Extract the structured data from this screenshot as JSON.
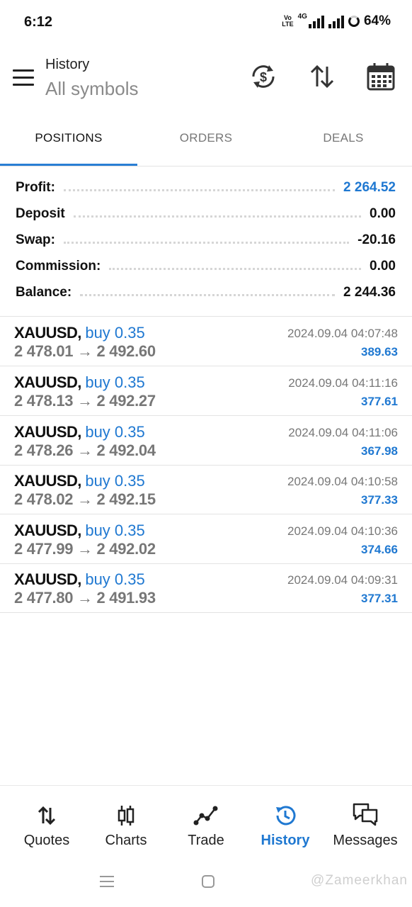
{
  "status_bar": {
    "time": "6:12",
    "volte": "Vo\nLTE",
    "network": "4G",
    "battery": "64%"
  },
  "app_bar": {
    "title": "History",
    "subtitle": "All symbols",
    "icons": [
      "currency-sync-icon",
      "sort-icon",
      "calendar-icon"
    ]
  },
  "tabs": [
    {
      "label": "POSITIONS",
      "active": true
    },
    {
      "label": "ORDERS",
      "active": false
    },
    {
      "label": "DEALS",
      "active": false
    }
  ],
  "summary": {
    "profit_label": "Profit:",
    "profit_value": "2 264.52",
    "deposit_label": "Deposit",
    "deposit_value": "0.00",
    "swap_label": "Swap:",
    "swap_value": "-20.16",
    "commission_label": "Commission:",
    "commission_value": "0.00",
    "balance_label": "Balance:",
    "balance_value": "2 244.36"
  },
  "trades": [
    {
      "symbol": "XAUUSD,",
      "direction": "buy 0.35",
      "prices": "2 478.01 → 2 492.60",
      "time": "2024.09.04 04:07:48",
      "profit": "389.63"
    },
    {
      "symbol": "XAUUSD,",
      "direction": "buy 0.35",
      "prices": "2 478.13 → 2 492.27",
      "time": "2024.09.04 04:11:16",
      "profit": "377.61"
    },
    {
      "symbol": "XAUUSD,",
      "direction": "buy 0.35",
      "prices": "2 478.26 → 2 492.04",
      "time": "2024.09.04 04:11:06",
      "profit": "367.98"
    },
    {
      "symbol": "XAUUSD,",
      "direction": "buy 0.35",
      "prices": "2 478.02 → 2 492.15",
      "time": "2024.09.04 04:10:58",
      "profit": "377.33"
    },
    {
      "symbol": "XAUUSD,",
      "direction": "buy 0.35",
      "prices": "2 477.99 → 2 492.02",
      "time": "2024.09.04 04:10:36",
      "profit": "374.66"
    },
    {
      "symbol": "XAUUSD,",
      "direction": "buy 0.35",
      "prices": "2 477.80 → 2 491.93",
      "time": "2024.09.04 04:09:31",
      "profit": "377.31"
    }
  ],
  "bottom_nav": [
    {
      "label": "Quotes",
      "icon": "quotes-icon",
      "active": false
    },
    {
      "label": "Charts",
      "icon": "candlestick-icon",
      "active": false
    },
    {
      "label": "Trade",
      "icon": "trade-line-icon",
      "active": false
    },
    {
      "label": "History",
      "icon": "history-icon",
      "active": true
    },
    {
      "label": "Messages",
      "icon": "messages-icon",
      "active": false
    }
  ],
  "watermark": "@Zameerkhan",
  "colors": {
    "accent": "#1f78d1",
    "tab_indicator": "#2a7fd4",
    "muted": "#777777"
  }
}
